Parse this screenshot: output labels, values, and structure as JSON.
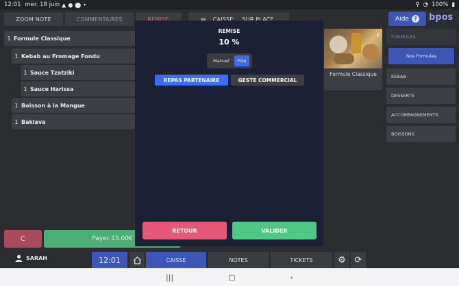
{
  "status_bar": {
    "time": "12:01",
    "date": "mer. 18 juin",
    "battery": "100%"
  },
  "top_buttons": {
    "zoom_note": "ZOOM NOTE",
    "commentaires": "COMMENTAIRES",
    "remise": "REMISE",
    "caisse": "CAISSE:",
    "caisse_mode": "SUR PLACE"
  },
  "order": {
    "items": [
      {
        "qty": "1",
        "name": "Formule Classique"
      },
      {
        "qty": "1",
        "name": "Kebab au Fromage Fondu"
      },
      {
        "qty": "1",
        "name": "Sauce Tzatziki"
      },
      {
        "qty": "1",
        "name": "Sauce Harissa"
      },
      {
        "qty": "1",
        "name": "Boisson à la Mangue"
      },
      {
        "qty": "1",
        "name": "Baklava"
      }
    ]
  },
  "actions": {
    "clear": "C",
    "pay": "Payer 15.00€"
  },
  "modal": {
    "title": "REMISE",
    "value": "10 %",
    "mode_options": [
      "Manuel",
      "Fixe"
    ],
    "selected_mode": "Fixe",
    "reasons": [
      "REPAS PARTENAIRE",
      "GESTE COMMERCIAL"
    ],
    "selected_reason": "REPAS PARTENAIRE",
    "retour": "RETOUR",
    "valider": "VALIDER"
  },
  "right_panel": {
    "aide": "Aide",
    "aide_icon": "?",
    "logo": "bpos",
    "product_card": {
      "name": "Formule Classique",
      "info": "i"
    },
    "categories": [
      "FORMULES",
      "KEBAB",
      "DESSERTS",
      "ACCOMPAGNEMENTS",
      "BOISSONS"
    ],
    "subcategory": "Nos Formules"
  },
  "bottom_bar": {
    "user": "SARAH",
    "time": "12:01",
    "tabs": [
      "CAISSE",
      "NOTES",
      "TICKETS"
    ]
  },
  "colors": {
    "accent": "#3e56b8",
    "danger": "#e65875",
    "success": "#4cc985",
    "modal_bg": "#1c2034"
  }
}
